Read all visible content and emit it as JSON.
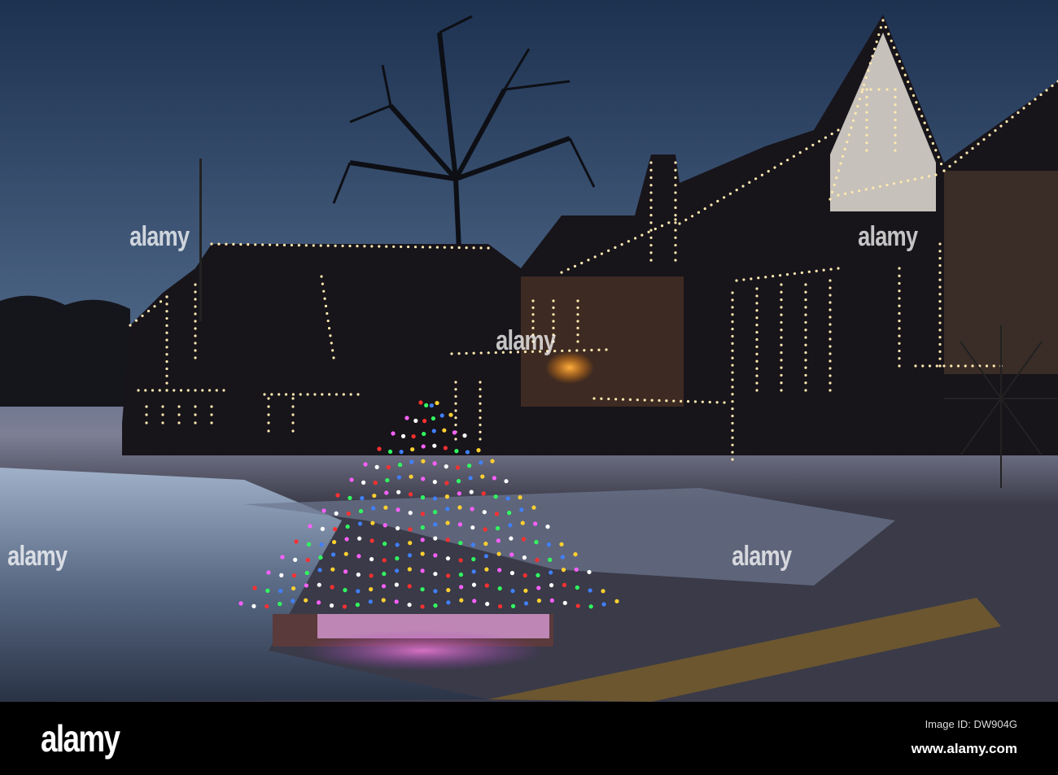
{
  "footer": {
    "logo": "alamy",
    "image_id": "Image ID: DW904G",
    "website": "www.alamy.com"
  },
  "watermark": "alamy",
  "colors": {
    "sky_top": "#1f3350",
    "sky_bottom": "#5a6f8e",
    "lights": "#ffe9b0",
    "ice": "#8fa3bf"
  }
}
